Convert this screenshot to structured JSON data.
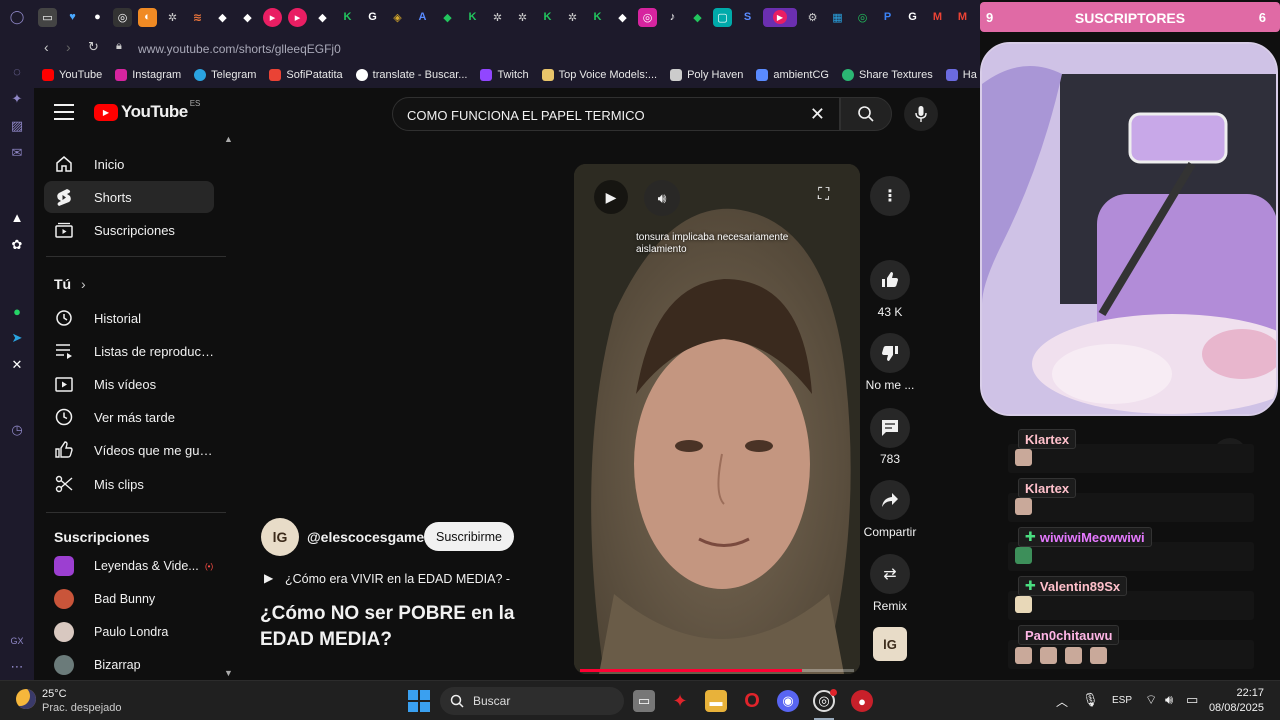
{
  "browser": {
    "url": "www.youtube.com/shorts/glleeqEGFj0",
    "bookmarks": [
      "YouTube",
      "Instagram",
      "Telegram",
      "SofiPatatita",
      "translate - Buscar...",
      "Twitch",
      "Top Voice Models:...",
      "Poly Haven",
      "ambientCG",
      "Share Textures",
      "Ha"
    ]
  },
  "youtube": {
    "logo_text": "YouTube",
    "region": "ES",
    "search_value": "COMO FUNCIONA EL PAPEL TERMICO",
    "nav": [
      "Inicio",
      "Shorts",
      "Suscripciones"
    ],
    "you_section": "Tú",
    "you_items": [
      "Historial",
      "Listas de reproducc...",
      "Mis vídeos",
      "Ver más tarde",
      "Vídeos que me gus...",
      "Mis clips"
    ],
    "subs_title": "Suscripciones",
    "subs": [
      "Leyendas & Vide...",
      "Bad Bunny",
      "Paulo Londra",
      "Bizarrap"
    ],
    "subs_live_badge": "(•)",
    "short": {
      "channel": "@elescocesgamer",
      "subscribe_label": "Suscribirme",
      "playlist_line": "¿Cómo era VIVIR en la EDAD MEDIA? -",
      "title": "¿Cómo NO ser POBRE en la EDAD MEDIA?",
      "caption": "tonsura implicaba necesariamente aislamiento",
      "likes": "43 K",
      "dislike_label": "No me ...",
      "comments": "783",
      "share_label": "Compartir",
      "remix_label": "Remix"
    }
  },
  "stream_panel": {
    "goal_left": "9",
    "goal_title": "SUSCRIPTORES",
    "goal_right": "6",
    "chat": [
      {
        "name": "Klartex",
        "color": "#ffc0cb"
      },
      {
        "name": "Klartex",
        "color": "#ffc0cb"
      },
      {
        "name": "wiwiwiMeowwiwi",
        "color": "#e679ff"
      },
      {
        "name": "Valentin89Sx",
        "color": "#ffc0cb"
      },
      {
        "name": "Pan0chitauwu",
        "color": "#ffb6e6"
      }
    ]
  },
  "taskbar": {
    "temperature": "25°C",
    "weather": "Prac. despejado",
    "search_label": "Buscar",
    "lang": "ESP",
    "time": "22:17",
    "date": "08/08/2025"
  },
  "colors": {
    "youtube_red": "#ff0000",
    "opera_bg": "#1d1a2b",
    "goal_pink": "#e06aa5"
  }
}
